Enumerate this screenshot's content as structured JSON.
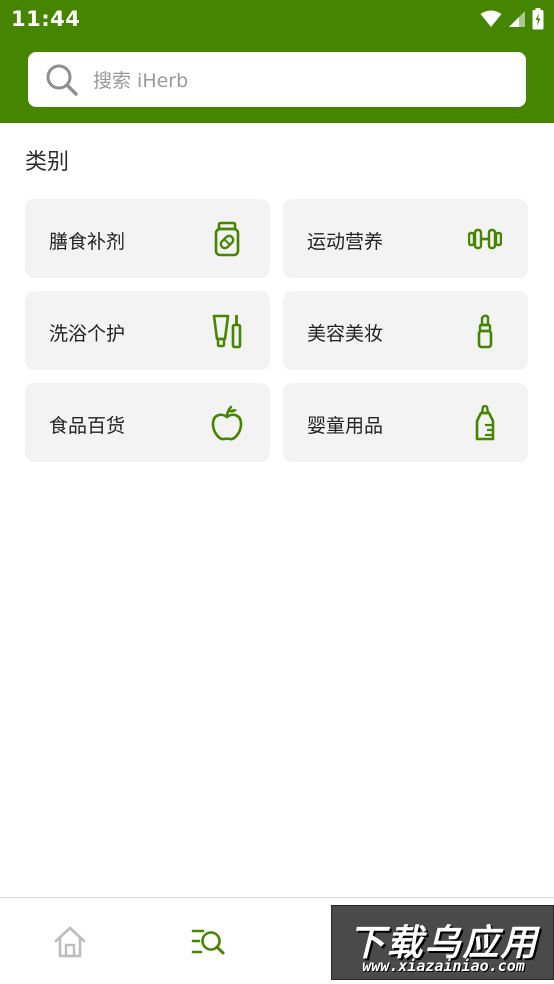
{
  "status_bar": {
    "time": "11:44"
  },
  "search": {
    "placeholder": "搜索 iHerb"
  },
  "section": {
    "title": "类别"
  },
  "categories": [
    {
      "label": "膳食补剂",
      "icon": "supplement-jar-icon"
    },
    {
      "label": "运动营养",
      "icon": "dumbbell-icon"
    },
    {
      "label": "洗浴个护",
      "icon": "tube-bottle-icon"
    },
    {
      "label": "美容美妆",
      "icon": "lipstick-icon"
    },
    {
      "label": "食品百货",
      "icon": "apple-icon"
    },
    {
      "label": "婴童用品",
      "icon": "baby-bottle-icon"
    }
  ],
  "bottom_nav": {
    "items": [
      {
        "icon": "home-icon",
        "active": false
      },
      {
        "icon": "category-search-icon",
        "active": true
      }
    ]
  },
  "watermark": {
    "main": "下载乌应用",
    "sub": "www.xiazainiao.com"
  },
  "colors": {
    "brand_green": "#458500",
    "card_bg": "#f3f3f3",
    "inactive_icon": "#bdbdbd"
  }
}
